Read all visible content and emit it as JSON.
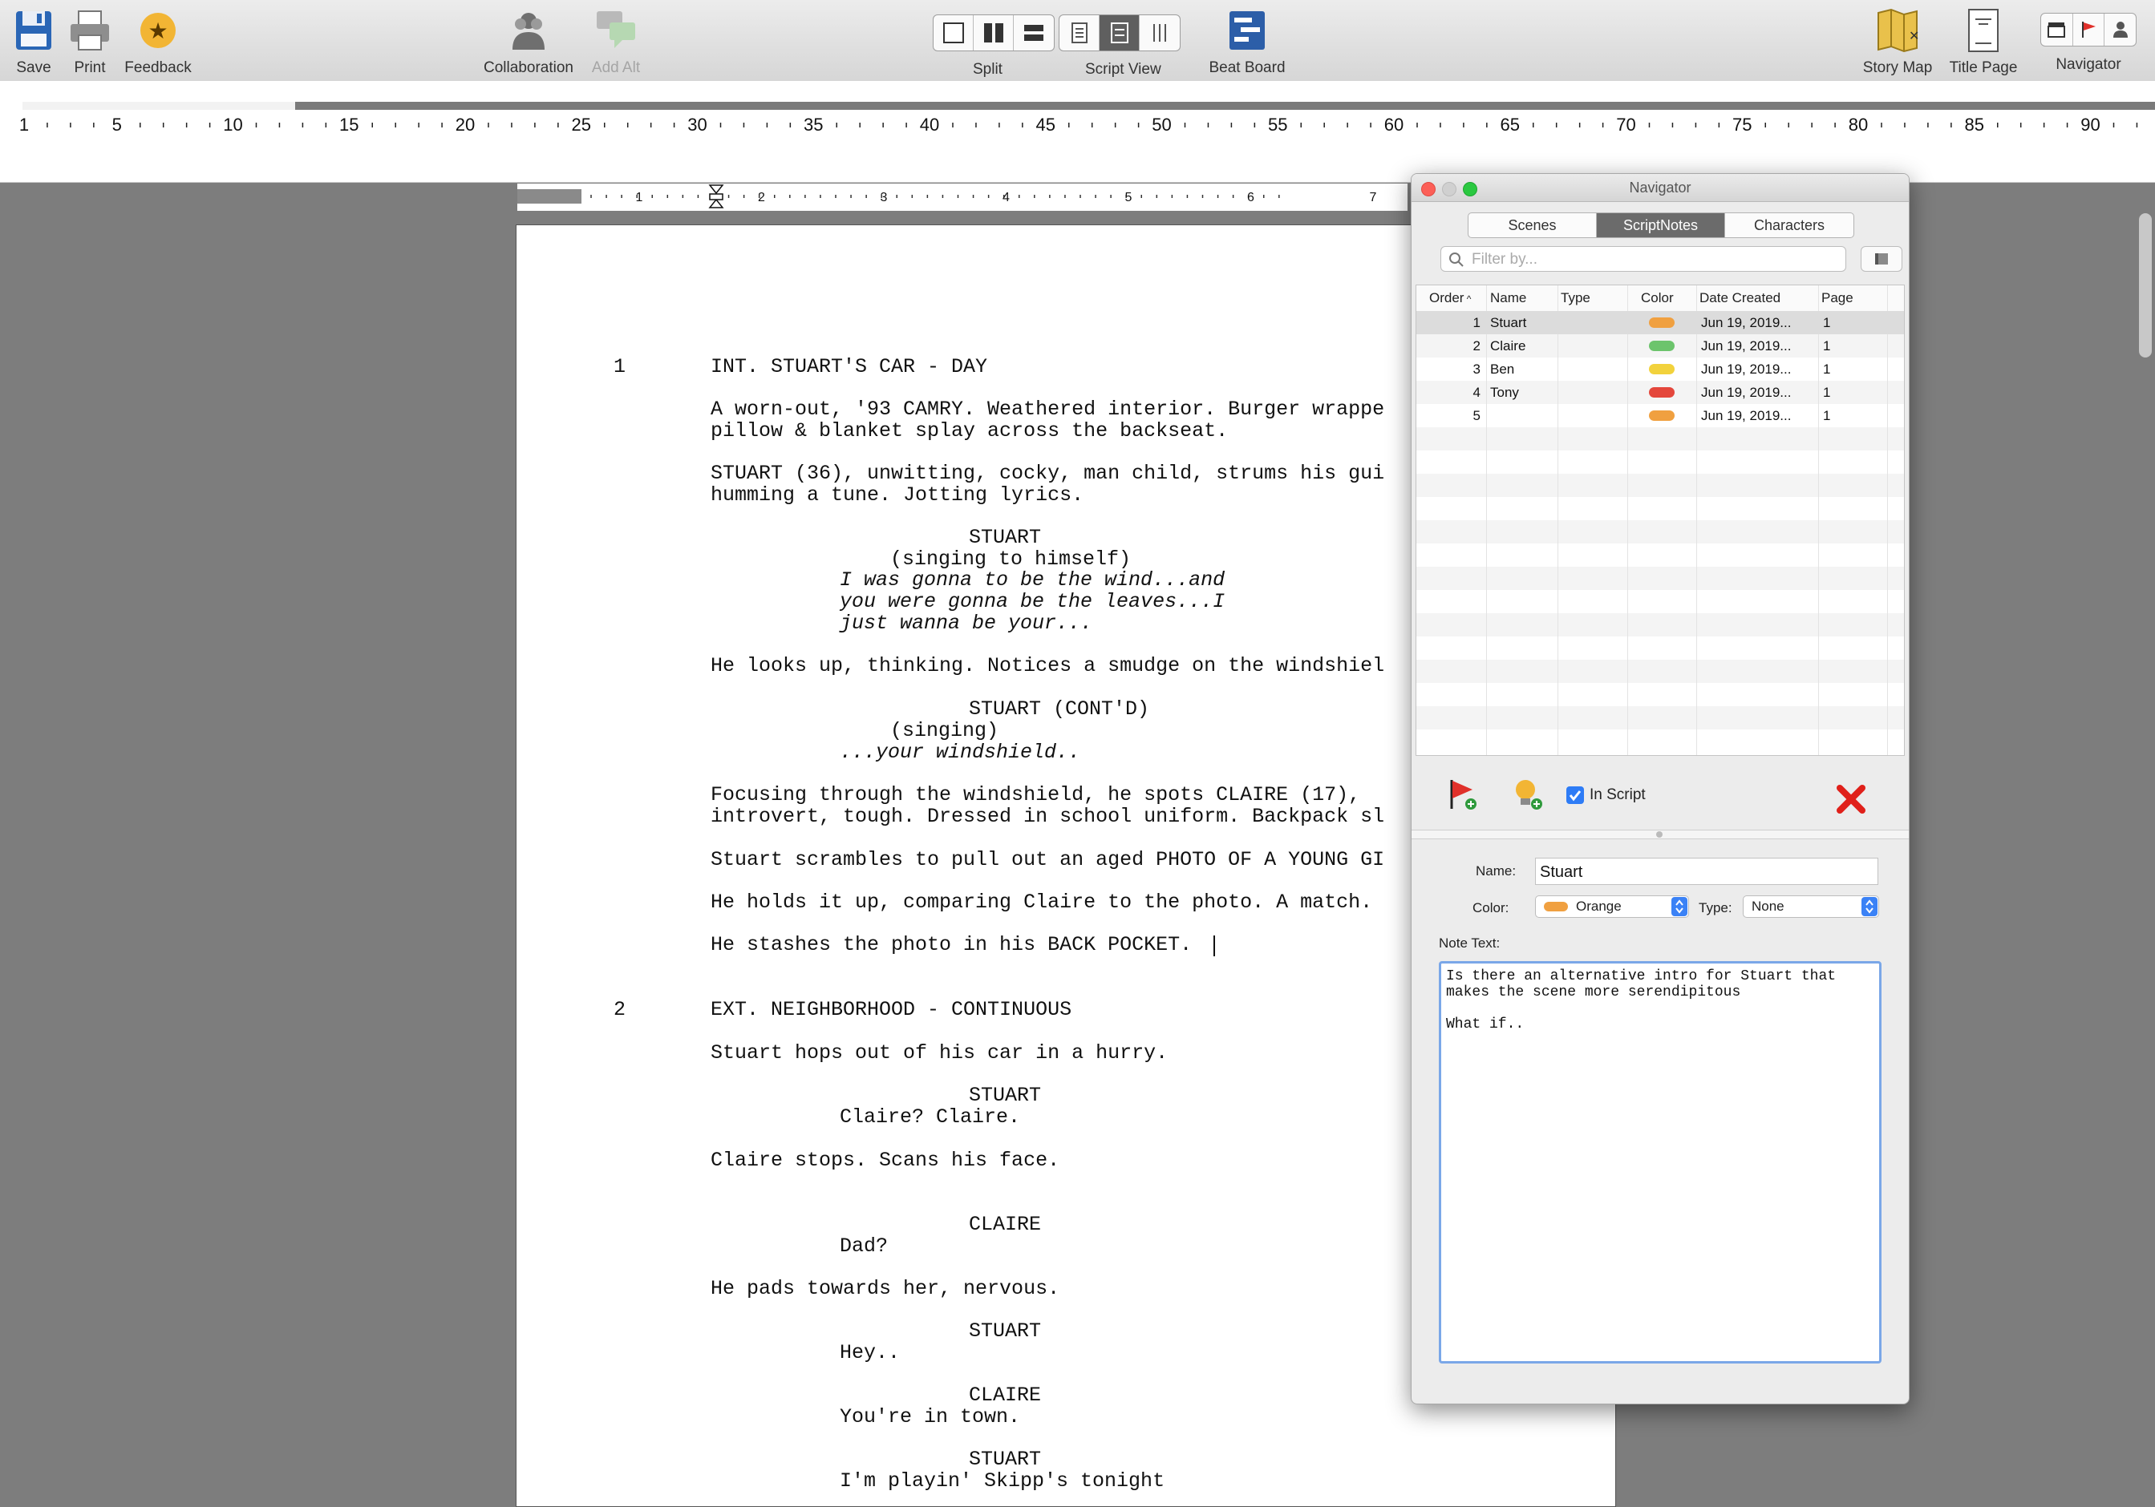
{
  "toolbar": {
    "save": "Save",
    "print": "Print",
    "feedback": "Feedback",
    "collaboration": "Collaboration",
    "add_alt": "Add Alt",
    "split": "Split",
    "script_view": "Script View",
    "beat_board": "Beat Board",
    "story_map": "Story Map",
    "title_page": "Title Page",
    "navigator": "Navigator"
  },
  "ruler": {
    "numbers": [
      "1",
      "5",
      "10",
      "15",
      "20",
      "25",
      "30",
      "35",
      "40",
      "45",
      "50",
      "55",
      "60",
      "65",
      "70",
      "75",
      "80",
      "85",
      "90"
    ]
  },
  "page_ruler": {
    "numbers": [
      "1",
      "2",
      "3",
      "4",
      "5",
      "6",
      "7"
    ]
  },
  "script": {
    "scene1_number": "1",
    "scene1_heading": "INT. STUART'S CAR - DAY",
    "a1": "A worn-out, '93 CAMRY. Weathered interior. Burger wrappe",
    "a2": "pillow & blanket splay across the backseat.",
    "a3": "STUART (36), unwitting, cocky, man child, strums his gui",
    "a4": "humming a tune. Jotting lyrics.",
    "c1": "STUART",
    "p1": "(singing to himself)",
    "d1": "I was gonna to be the wind...and",
    "d2": "you were gonna be the leaves...I",
    "d3": "just wanna be your...",
    "a5": "He looks up, thinking. Notices a smudge on the windshiel",
    "c2": "STUART (CONT'D)",
    "p2": "(singing)",
    "d4": "...your windshield..",
    "a6": "Focusing through the windshield, he spots CLAIRE (17),",
    "a7": "introvert, tough. Dressed in school uniform. Backpack sl",
    "a8": "Stuart scrambles to pull out an aged PHOTO OF A YOUNG GI",
    "a9": "He holds it up, comparing Claire to the photo. A match.",
    "a10": "He stashes the photo in his BACK POCKET.",
    "scene2_number": "2",
    "scene2_heading": "EXT. NEIGHBORHOOD - CONTINUOUS",
    "a11": "Stuart hops out of his car in a hurry.",
    "c3": "STUART",
    "d5": "Claire? Claire.",
    "a12": "Claire stops. Scans his face.",
    "c4": "CLAIRE",
    "d6": "Dad?",
    "a13": "He pads towards her, nervous.",
    "c5": "STUART",
    "d7": "Hey..",
    "c6": "CLAIRE",
    "d8": "You're in town.",
    "c7": "STUART",
    "d9": "I'm playin' Skipp's tonight"
  },
  "navigator": {
    "title": "Navigator",
    "tabs": [
      "Scenes",
      "ScriptNotes",
      "Characters"
    ],
    "filter_placeholder": "Filter by...",
    "columns": [
      "Order",
      "Name",
      "Type",
      "Color",
      "Date Created",
      "Page"
    ],
    "rows": [
      {
        "order": "1",
        "name": "Stuart",
        "type": "",
        "color": "#f0a040",
        "date": "Jun 19, 2019...",
        "page": "1"
      },
      {
        "order": "2",
        "name": "Claire",
        "type": "",
        "color": "#6cc46c",
        "date": "Jun 19, 2019...",
        "page": "1"
      },
      {
        "order": "3",
        "name": "Ben",
        "type": "",
        "color": "#f2d23c",
        "date": "Jun 19, 2019...",
        "page": "1"
      },
      {
        "order": "4",
        "name": "Tony",
        "type": "",
        "color": "#e4473c",
        "date": "Jun 19, 2019...",
        "page": "1"
      },
      {
        "order": "5",
        "name": "",
        "type": "",
        "color": "#f0a040",
        "date": "Jun 19, 2019...",
        "page": "1"
      }
    ],
    "in_script_label": "In Script",
    "in_script_checked": true,
    "name_label": "Name:",
    "name_value": "Stuart",
    "color_label": "Color:",
    "color_value": "Orange",
    "color_swatch": "#f0a040",
    "type_label": "Type:",
    "type_value": "None",
    "note_label": "Note Text:",
    "note_text": "Is there an alternative intro for Stuart that\nmakes the scene more serendipitous\n\nWhat if.."
  }
}
